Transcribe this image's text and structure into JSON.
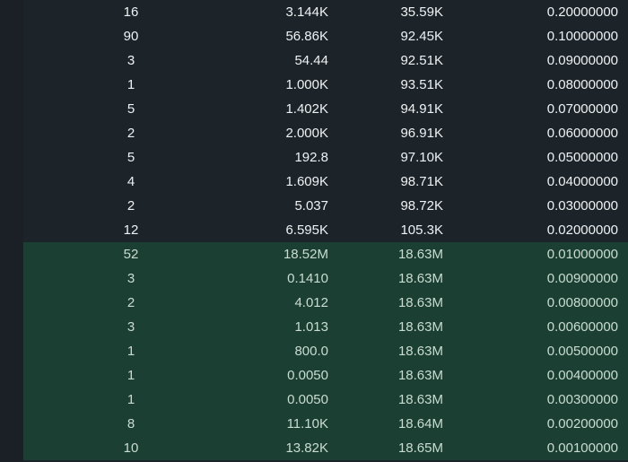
{
  "order_book": {
    "rows": [
      {
        "count": "16",
        "size": "3.144K",
        "total": "35.59K",
        "price": "0.20000000",
        "side": "ask"
      },
      {
        "count": "90",
        "size": "56.86K",
        "total": "92.45K",
        "price": "0.10000000",
        "side": "ask"
      },
      {
        "count": "3",
        "size": "54.44",
        "total": "92.51K",
        "price": "0.09000000",
        "side": "ask"
      },
      {
        "count": "1",
        "size": "1.000K",
        "total": "93.51K",
        "price": "0.08000000",
        "side": "ask"
      },
      {
        "count": "5",
        "size": "1.402K",
        "total": "94.91K",
        "price": "0.07000000",
        "side": "ask"
      },
      {
        "count": "2",
        "size": "2.000K",
        "total": "96.91K",
        "price": "0.06000000",
        "side": "ask"
      },
      {
        "count": "5",
        "size": "192.8",
        "total": "97.10K",
        "price": "0.05000000",
        "side": "ask"
      },
      {
        "count": "4",
        "size": "1.609K",
        "total": "98.71K",
        "price": "0.04000000",
        "side": "ask"
      },
      {
        "count": "2",
        "size": "5.037",
        "total": "98.72K",
        "price": "0.03000000",
        "side": "ask"
      },
      {
        "count": "12",
        "size": "6.595K",
        "total": "105.3K",
        "price": "0.02000000",
        "side": "ask"
      },
      {
        "count": "52",
        "size": "18.52M",
        "total": "18.63M",
        "price": "0.01000000",
        "side": "bid"
      },
      {
        "count": "3",
        "size": "0.1410",
        "total": "18.63M",
        "price": "0.00900000",
        "side": "bid"
      },
      {
        "count": "2",
        "size": "4.012",
        "total": "18.63M",
        "price": "0.00800000",
        "side": "bid"
      },
      {
        "count": "3",
        "size": "1.013",
        "total": "18.63M",
        "price": "0.00600000",
        "side": "bid"
      },
      {
        "count": "1",
        "size": "800.0",
        "total": "18.63M",
        "price": "0.00500000",
        "side": "bid"
      },
      {
        "count": "1",
        "size": "0.0050",
        "total": "18.63M",
        "price": "0.00400000",
        "side": "bid"
      },
      {
        "count": "1",
        "size": "0.0050",
        "total": "18.63M",
        "price": "0.00300000",
        "side": "bid"
      },
      {
        "count": "8",
        "size": "11.10K",
        "total": "18.64M",
        "price": "0.00200000",
        "side": "bid"
      },
      {
        "count": "10",
        "size": "13.82K",
        "total": "18.65M",
        "price": "0.00100000",
        "side": "bid"
      }
    ]
  },
  "colors": {
    "background": "#1c2329",
    "bid_highlight": "#1c3f33",
    "text": "#eef2f4"
  }
}
